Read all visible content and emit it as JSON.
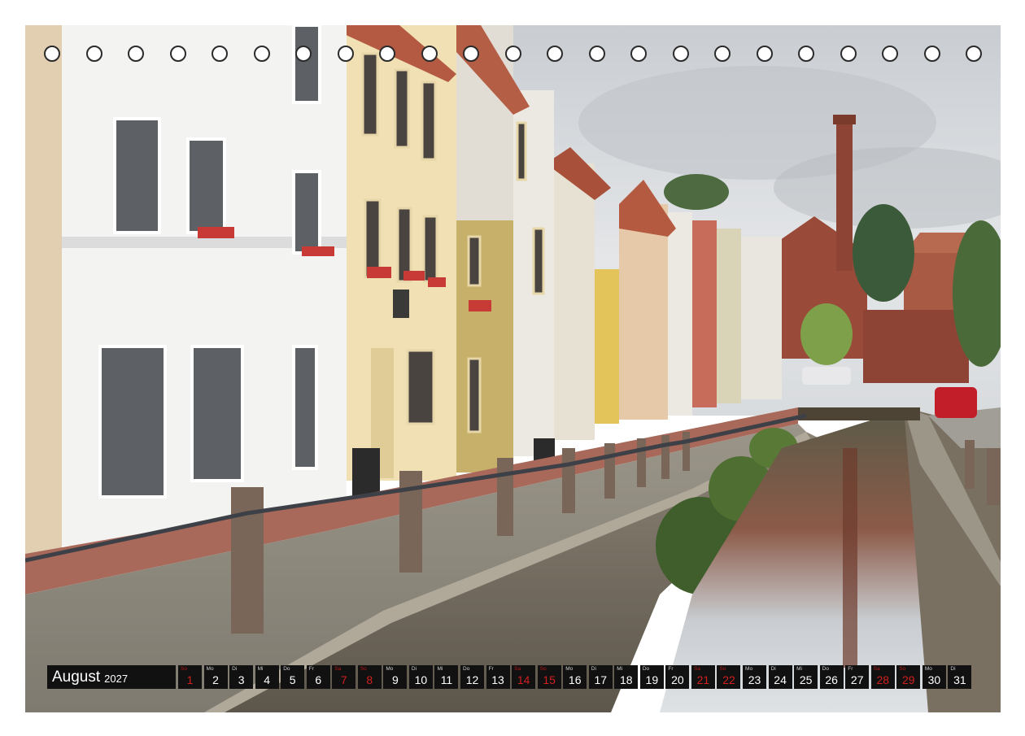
{
  "calendar": {
    "month": "August",
    "year": "2027",
    "days": [
      {
        "d": "1",
        "wd": "So",
        "weekend": true
      },
      {
        "d": "2",
        "wd": "Mo",
        "weekend": false
      },
      {
        "d": "3",
        "wd": "Di",
        "weekend": false
      },
      {
        "d": "4",
        "wd": "Mi",
        "weekend": false
      },
      {
        "d": "5",
        "wd": "Do",
        "weekend": false
      },
      {
        "d": "6",
        "wd": "Fr",
        "weekend": false
      },
      {
        "d": "7",
        "wd": "Sa",
        "weekend": true
      },
      {
        "d": "8",
        "wd": "So",
        "weekend": true
      },
      {
        "d": "9",
        "wd": "Mo",
        "weekend": false
      },
      {
        "d": "10",
        "wd": "Di",
        "weekend": false
      },
      {
        "d": "11",
        "wd": "Mi",
        "weekend": false
      },
      {
        "d": "12",
        "wd": "Do",
        "weekend": false
      },
      {
        "d": "13",
        "wd": "Fr",
        "weekend": false
      },
      {
        "d": "14",
        "wd": "Sa",
        "weekend": true
      },
      {
        "d": "15",
        "wd": "So",
        "weekend": true
      },
      {
        "d": "16",
        "wd": "Mo",
        "weekend": false
      },
      {
        "d": "17",
        "wd": "Di",
        "weekend": false
      },
      {
        "d": "18",
        "wd": "Mi",
        "weekend": false
      },
      {
        "d": "19",
        "wd": "Do",
        "weekend": false
      },
      {
        "d": "20",
        "wd": "Fr",
        "weekend": false
      },
      {
        "d": "21",
        "wd": "Sa",
        "weekend": true
      },
      {
        "d": "22",
        "wd": "So",
        "weekend": true
      },
      {
        "d": "23",
        "wd": "Mo",
        "weekend": false
      },
      {
        "d": "24",
        "wd": "Di",
        "weekend": false
      },
      {
        "d": "25",
        "wd": "Mi",
        "weekend": false
      },
      {
        "d": "26",
        "wd": "Do",
        "weekend": false
      },
      {
        "d": "27",
        "wd": "Fr",
        "weekend": false
      },
      {
        "d": "28",
        "wd": "Sa",
        "weekend": true
      },
      {
        "d": "29",
        "wd": "So",
        "weekend": true
      },
      {
        "d": "30",
        "wd": "Mo",
        "weekend": false
      },
      {
        "d": "31",
        "wd": "Di",
        "weekend": false
      }
    ]
  },
  "colors": {
    "weekend": "#d21e1e",
    "bar": "#111111"
  }
}
